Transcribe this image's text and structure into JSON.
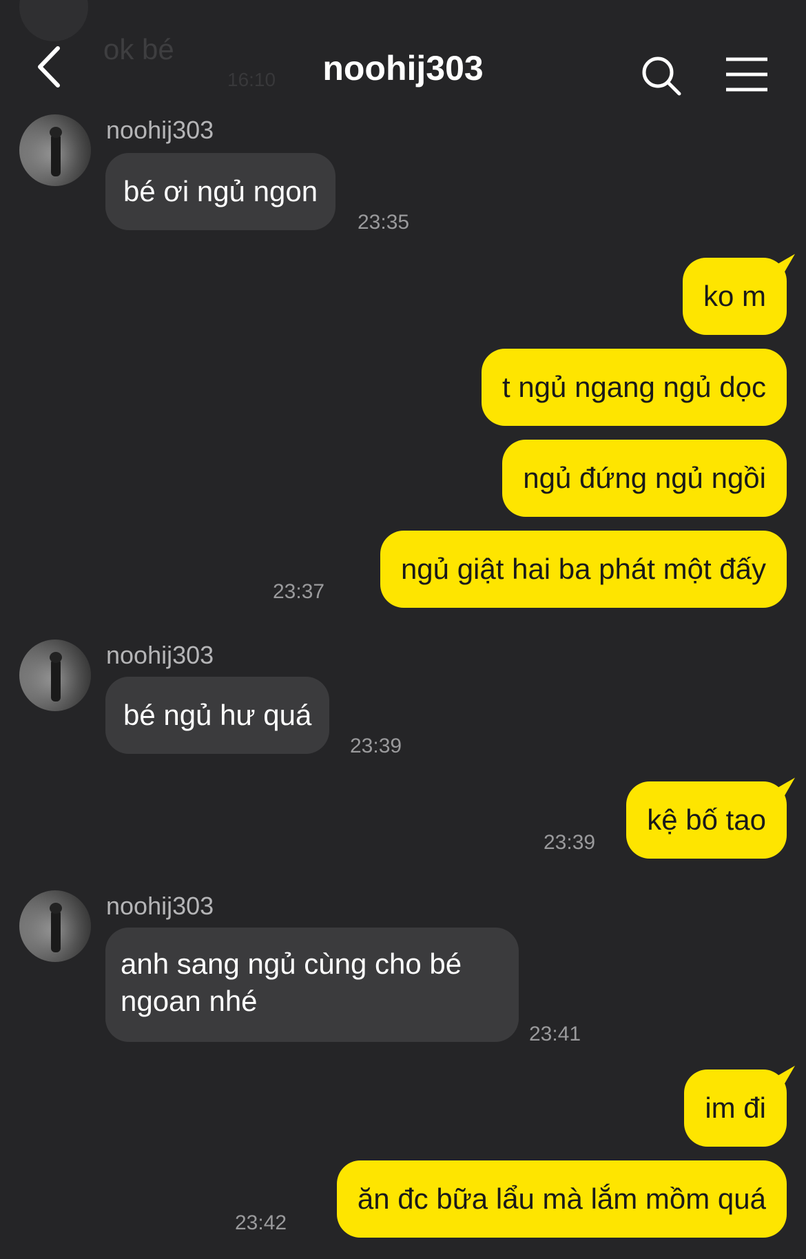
{
  "header": {
    "title": "noohij303",
    "faded_prev_text": "ok bé",
    "faded_prev_time": "16:10"
  },
  "messages": [
    {
      "sender": "noohij303",
      "text": "bé ơi ngủ ngon",
      "time": "23:35"
    },
    {
      "text": "ko m"
    },
    {
      "text": "t ngủ ngang ngủ dọc"
    },
    {
      "text": "ngủ đứng ngủ ngồi"
    },
    {
      "text": "ngủ giật hai ba phát một đấy",
      "time": "23:37"
    },
    {
      "sender": "noohij303",
      "text": "bé ngủ hư quá",
      "time": "23:39"
    },
    {
      "text": "kệ bố tao",
      "time": "23:39"
    },
    {
      "sender": "noohij303",
      "line1": "anh sang ngủ cùng cho bé",
      "line2": "ngoan nhé",
      "time": "23:41"
    },
    {
      "text": "im đi"
    },
    {
      "text": "ăn đc bữa lẩu mà lắm mồm quá",
      "time": "23:42"
    }
  ],
  "colors": {
    "background": "#252527",
    "incoming_bubble": "#3b3b3d",
    "outgoing_bubble": "#fee500"
  }
}
